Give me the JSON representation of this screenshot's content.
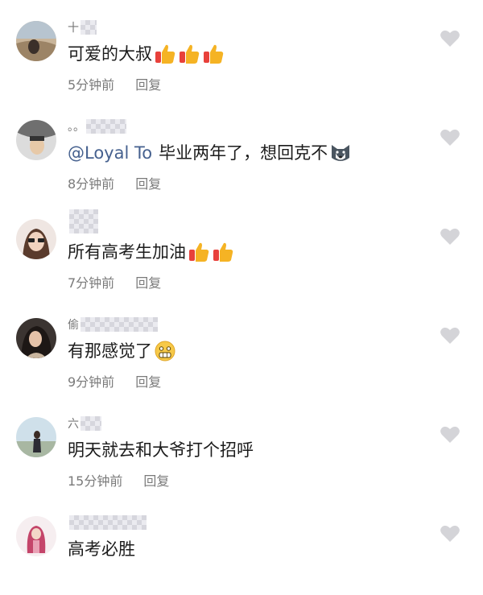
{
  "comments": [
    {
      "nickname": "十",
      "text": "可爱的大叔",
      "mention": "",
      "emojis": [
        "thumbs-up-emoji",
        "thumbs-up-emoji",
        "thumbs-up-emoji"
      ],
      "time": "5分钟前",
      "reply_label": "回复"
    },
    {
      "nickname": "。。",
      "text": "毕业两年了，想回克不",
      "mention": "@Loyal To",
      "emojis": [
        "husky-emoji"
      ],
      "time": "8分钟前",
      "reply_label": "回复"
    },
    {
      "nickname": "",
      "text": "所有高考生加油",
      "mention": "",
      "emojis": [
        "thumbs-up-emoji",
        "thumbs-up-emoji"
      ],
      "time": "7分钟前",
      "reply_label": "回复"
    },
    {
      "nickname": "偷",
      "text": "有那感觉了",
      "mention": "",
      "emojis": [
        "grimace-emoji"
      ],
      "time": "9分钟前",
      "reply_label": "回复"
    },
    {
      "nickname": "六",
      "text": "明天就去和大爷打个招呼",
      "mention": "",
      "emojis": [],
      "time": "15分钟前",
      "reply_label": "回复"
    },
    {
      "nickname": "",
      "text": "高考必胜",
      "mention": "",
      "emojis": [],
      "time": "",
      "reply_label": ""
    }
  ],
  "colors": {
    "mention": "#46618f",
    "meta": "#7a7a7a",
    "heart": "#d4d4d8"
  }
}
